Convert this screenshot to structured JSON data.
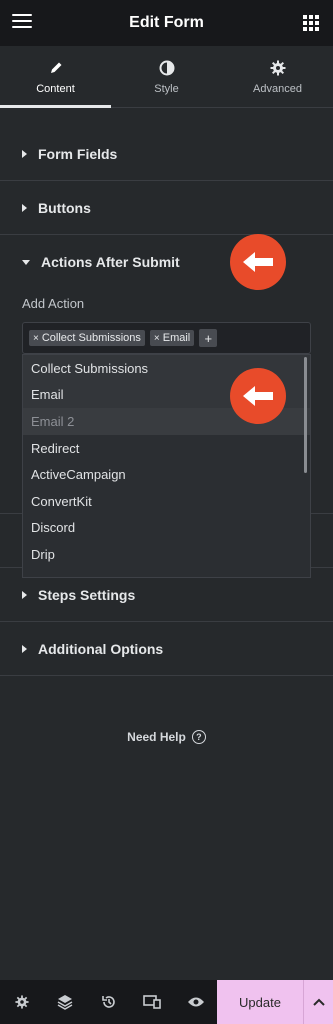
{
  "header": {
    "title": "Edit Form"
  },
  "tabs": [
    {
      "label": "Content",
      "icon": "pencil-icon",
      "active": true
    },
    {
      "label": "Style",
      "icon": "half-circle-icon",
      "active": false
    },
    {
      "label": "Advanced",
      "icon": "gear-icon",
      "active": false
    }
  ],
  "sections": {
    "form_fields": "Form Fields",
    "buttons": "Buttons",
    "actions_after_submit": "Actions After Submit",
    "steps_settings": "Steps Settings",
    "additional_options": "Additional Options"
  },
  "add_action": {
    "label": "Add Action",
    "chips": [
      "Collect Submissions",
      "Email"
    ],
    "add_symbol": "+"
  },
  "dropdown": {
    "options": [
      "Collect Submissions",
      "Email",
      "Email 2",
      "Redirect",
      "ActiveCampaign",
      "ConvertKit",
      "Discord",
      "Drip"
    ]
  },
  "help": {
    "label": "Need Help",
    "symbol": "?"
  },
  "footer": {
    "update_label": "Update"
  },
  "colors": {
    "accent_arrow": "#e84b2a",
    "update_bg": "#f0c2ef"
  }
}
